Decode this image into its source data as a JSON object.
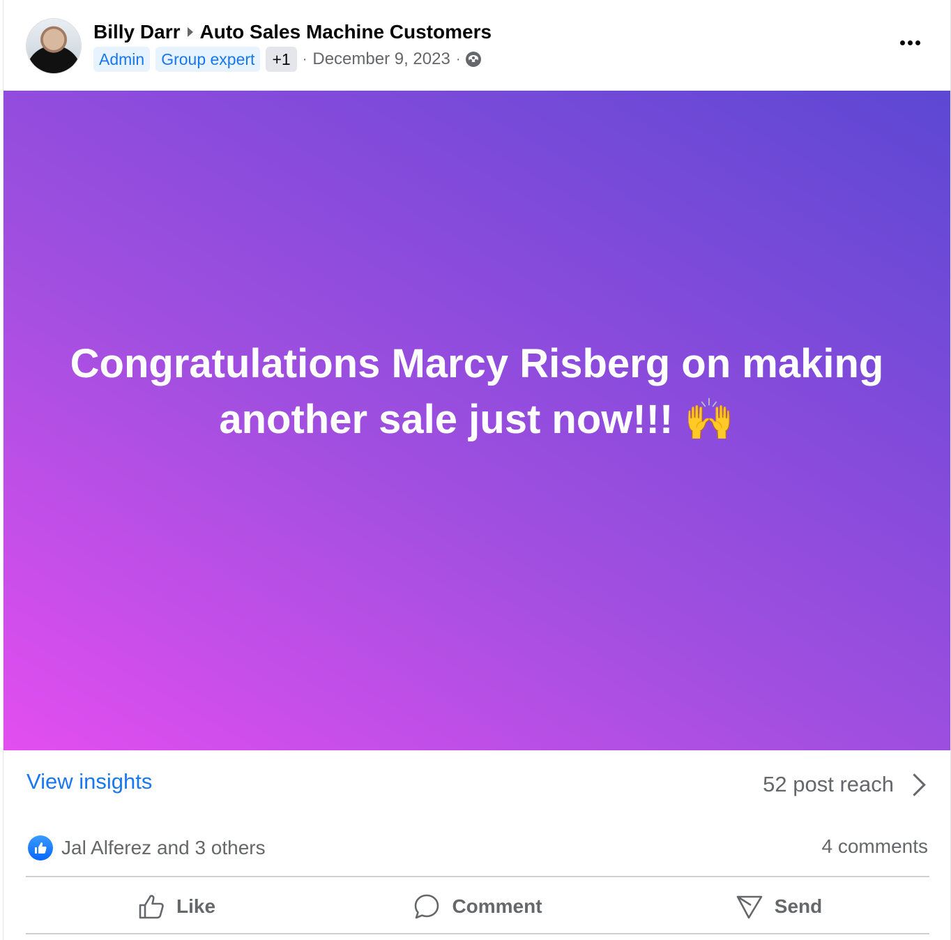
{
  "post": {
    "author": "Billy Darr",
    "group": "Auto Sales Machine Customers",
    "badges": [
      "Admin",
      "Group expert"
    ],
    "badge_more": "+1",
    "separator_dot": "·",
    "date": "December 9, 2023",
    "audience_icon": "globe-icon"
  },
  "banner": {
    "text": "Congratulations Marcy Risberg on making another sale just now!!! 🙌",
    "gradient_colors": [
      "#e34ef0",
      "#a34fe0",
      "#5c48d3"
    ]
  },
  "insights": {
    "link_label": "View insights",
    "reach_text": "52 post reach"
  },
  "reactions": {
    "summary": "Jal Alferez and 3 others",
    "comments": "4 comments"
  },
  "actions": {
    "like": "Like",
    "comment": "Comment",
    "send": "Send"
  },
  "colors": {
    "link": "#1877f2",
    "muted": "#65676b",
    "badge_bg": "#e7f3ff"
  }
}
